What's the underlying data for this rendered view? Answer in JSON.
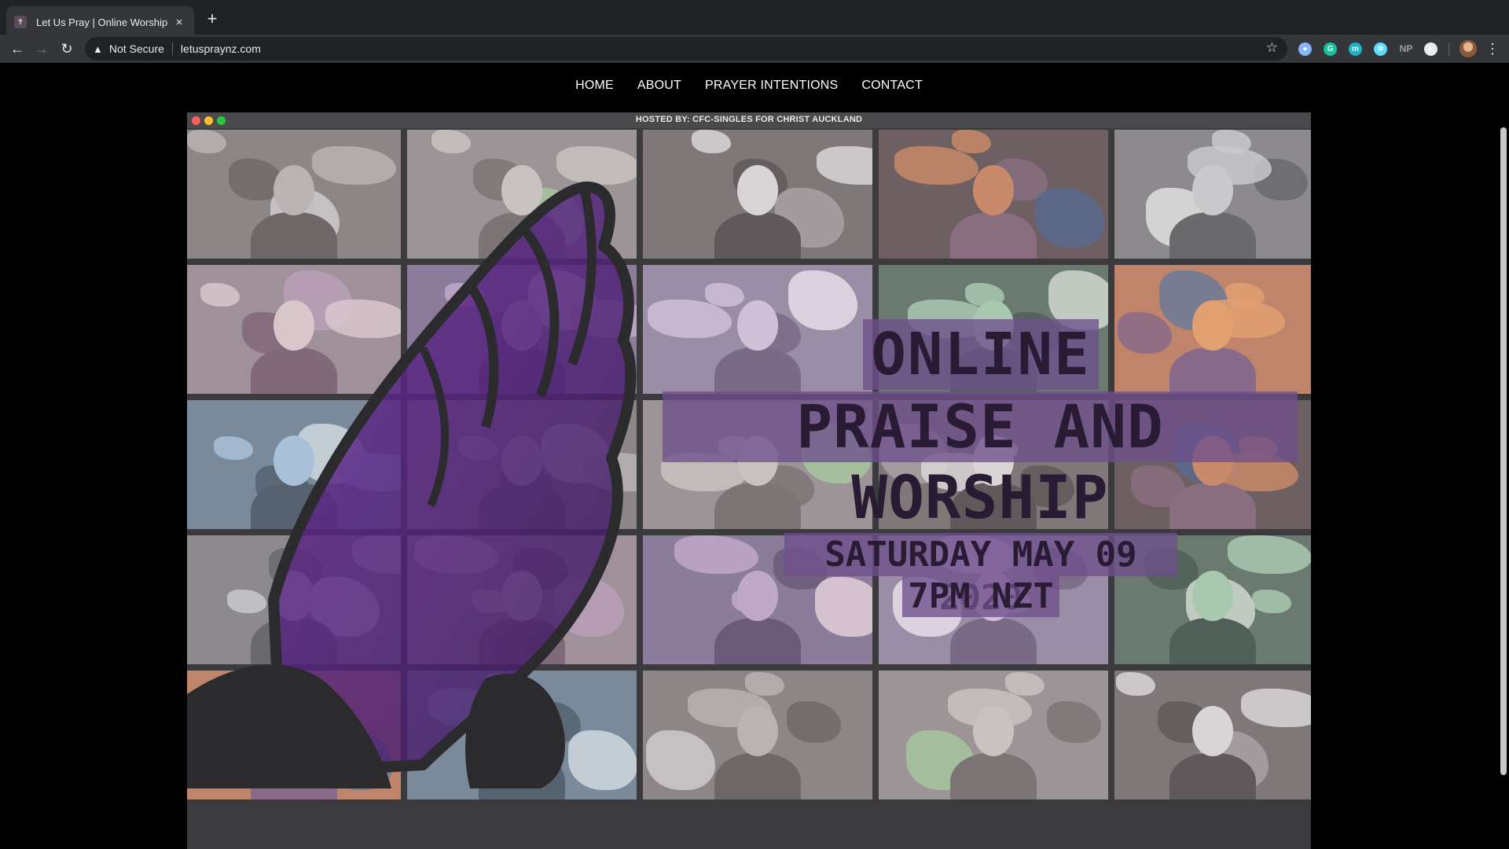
{
  "browser": {
    "tab_title": "Let Us Pray | Online Worship",
    "tab_close": "×",
    "new_tab": "+",
    "back": "←",
    "forward": "→",
    "reload": "↻",
    "security_icon": "warning-triangle-icon",
    "security_label": "Not Secure",
    "url": "letuspraynz.com",
    "bookmark_star": "☆",
    "extensions": [
      {
        "name": "circle-extension-icon",
        "color": "#8ab4f8",
        "glyph": "●"
      },
      {
        "name": "grammarly-extension-icon",
        "color": "#15c39a",
        "glyph": "G"
      },
      {
        "name": "m-extension-icon",
        "color": "#19b5c7",
        "glyph": "m"
      },
      {
        "name": "react-extension-icon",
        "color": "#61dafb",
        "glyph": "⚛"
      },
      {
        "name": "np-extension-icon",
        "color": "#9aa0a6",
        "glyph": "NP"
      },
      {
        "name": "contrast-extension-icon",
        "color": "#e8eaed",
        "glyph": "◐"
      }
    ],
    "menu": "⋮"
  },
  "site_nav": {
    "items": [
      "HOME",
      "ABOUT",
      "PRAYER INTENTIONS",
      "CONTACT"
    ]
  },
  "hero": {
    "hosted_by": "HOSTED BY: CFC-SINGLES FOR CHRIST AUCKLAND",
    "title_line1": "ONLINE",
    "title_line2": "PRAISE AND WORSHIP",
    "date": "SATURDAY MAY 09 2020",
    "time": "7PM NZT",
    "traffic_colors": [
      "#ff5f57",
      "#febc2e",
      "#28c840"
    ],
    "accent": "#6e508c"
  }
}
